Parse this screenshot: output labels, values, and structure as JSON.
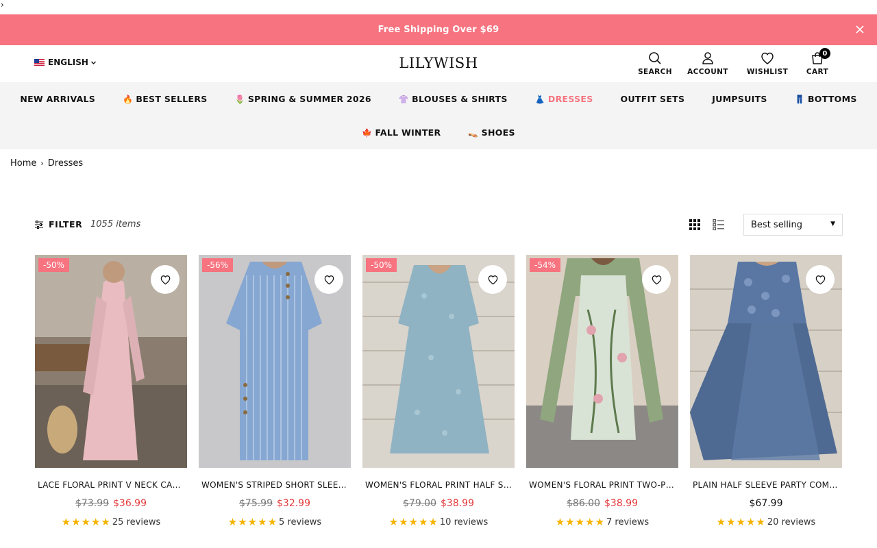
{
  "top_stub": "›",
  "promo": {
    "text": "Free Shipping Over $69"
  },
  "header": {
    "language": "ENGLISH",
    "logo": "LILYWISH",
    "icons": {
      "search": "SEARCH",
      "account": "ACCOUNT",
      "wishlist": "WISHLIST",
      "cart": "CART"
    },
    "cart_count": "0"
  },
  "nav": {
    "row1": [
      {
        "emoji": "",
        "label": "NEW ARRIVALS"
      },
      {
        "emoji": "🔥",
        "label": "BEST SELLERS"
      },
      {
        "emoji": "🌷",
        "label": "SPRING & SUMMER 2026"
      },
      {
        "emoji": "👚",
        "label": "BLOUSES & SHIRTS"
      },
      {
        "emoji": "👗",
        "label": "DRESSES",
        "active": true
      },
      {
        "emoji": "",
        "label": "OUTFIT SETS"
      },
      {
        "emoji": "",
        "label": "JUMPSUITS"
      },
      {
        "emoji": "👖",
        "label": "BOTTOMS"
      }
    ],
    "row2": [
      {
        "emoji": "🍁",
        "label": "FALL WINTER"
      },
      {
        "emoji": "👡",
        "label": "SHOES"
      }
    ]
  },
  "breadcrumb": {
    "home": "Home",
    "current": "Dresses"
  },
  "toolbar": {
    "filter_label": "FILTER",
    "item_count": "1055 items",
    "sort_value": "Best selling"
  },
  "products": [
    {
      "badge": "-50%",
      "title": "LACE FLORAL PRINT V NECK CASUAL DRESS",
      "old_price": "$73.99",
      "price": "$36.99",
      "stars": "★★★★★",
      "reviews": "25 reviews"
    },
    {
      "badge": "-56%",
      "title": "WOMEN'S STRIPED SHORT SLEEVE DRESS",
      "old_price": "$75.99",
      "price": "$32.99",
      "stars": "★★★★★",
      "reviews": "5 reviews"
    },
    {
      "badge": "-50%",
      "title": "WOMEN'S FLORAL PRINT HALF SLEEVE DRESS",
      "old_price": "$79.00",
      "price": "$38.99",
      "stars": "★★★★★",
      "reviews": "10 reviews"
    },
    {
      "badge": "-54%",
      "title": "WOMEN'S FLORAL PRINT TWO-PIECE DRESS",
      "old_price": "$86.00",
      "price": "$38.99",
      "stars": "★★★★★",
      "reviews": "7 reviews"
    },
    {
      "badge": "",
      "title": "PLAIN HALF SLEEVE PARTY COMFORT DRESS",
      "old_price": "",
      "price": "$67.99",
      "stars": "★★★★★",
      "reviews": "20 reviews"
    }
  ],
  "colors": {
    "accent": "#f6737f",
    "sale_price": "#e33b3b",
    "star": "#f5b301",
    "nav_bg": "#f4f4f4"
  }
}
